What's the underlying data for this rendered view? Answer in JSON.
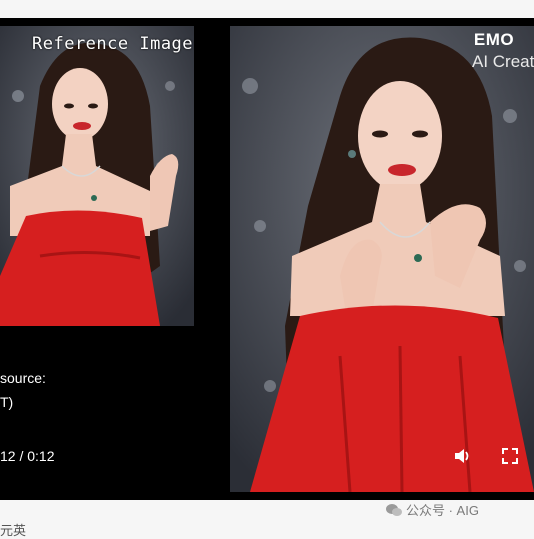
{
  "player": {
    "reference_label": "Reference Image",
    "title": "EMO",
    "subtitle": "AI Creat",
    "caption_line1": "source:",
    "caption_line2": "T)",
    "time": "12 / 0:12"
  },
  "footer": {
    "left_text": "元英",
    "watermark": "公众号 · AIG"
  },
  "colors": {
    "dress_red": "#d61f1f",
    "background": "#000000"
  }
}
